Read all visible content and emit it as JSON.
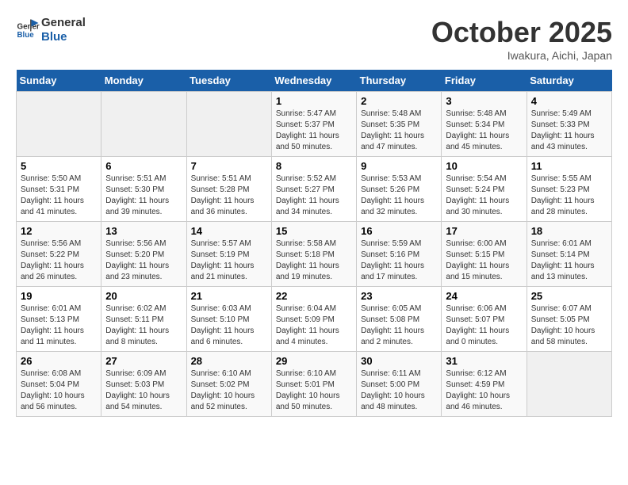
{
  "logo": {
    "line1": "General",
    "line2": "Blue"
  },
  "title": "October 2025",
  "subtitle": "Iwakura, Aichi, Japan",
  "days_of_week": [
    "Sunday",
    "Monday",
    "Tuesday",
    "Wednesday",
    "Thursday",
    "Friday",
    "Saturday"
  ],
  "weeks": [
    [
      {
        "day": "",
        "info": ""
      },
      {
        "day": "",
        "info": ""
      },
      {
        "day": "",
        "info": ""
      },
      {
        "day": "1",
        "info": "Sunrise: 5:47 AM\nSunset: 5:37 PM\nDaylight: 11 hours\nand 50 minutes."
      },
      {
        "day": "2",
        "info": "Sunrise: 5:48 AM\nSunset: 5:35 PM\nDaylight: 11 hours\nand 47 minutes."
      },
      {
        "day": "3",
        "info": "Sunrise: 5:48 AM\nSunset: 5:34 PM\nDaylight: 11 hours\nand 45 minutes."
      },
      {
        "day": "4",
        "info": "Sunrise: 5:49 AM\nSunset: 5:33 PM\nDaylight: 11 hours\nand 43 minutes."
      }
    ],
    [
      {
        "day": "5",
        "info": "Sunrise: 5:50 AM\nSunset: 5:31 PM\nDaylight: 11 hours\nand 41 minutes."
      },
      {
        "day": "6",
        "info": "Sunrise: 5:51 AM\nSunset: 5:30 PM\nDaylight: 11 hours\nand 39 minutes."
      },
      {
        "day": "7",
        "info": "Sunrise: 5:51 AM\nSunset: 5:28 PM\nDaylight: 11 hours\nand 36 minutes."
      },
      {
        "day": "8",
        "info": "Sunrise: 5:52 AM\nSunset: 5:27 PM\nDaylight: 11 hours\nand 34 minutes."
      },
      {
        "day": "9",
        "info": "Sunrise: 5:53 AM\nSunset: 5:26 PM\nDaylight: 11 hours\nand 32 minutes."
      },
      {
        "day": "10",
        "info": "Sunrise: 5:54 AM\nSunset: 5:24 PM\nDaylight: 11 hours\nand 30 minutes."
      },
      {
        "day": "11",
        "info": "Sunrise: 5:55 AM\nSunset: 5:23 PM\nDaylight: 11 hours\nand 28 minutes."
      }
    ],
    [
      {
        "day": "12",
        "info": "Sunrise: 5:56 AM\nSunset: 5:22 PM\nDaylight: 11 hours\nand 26 minutes."
      },
      {
        "day": "13",
        "info": "Sunrise: 5:56 AM\nSunset: 5:20 PM\nDaylight: 11 hours\nand 23 minutes."
      },
      {
        "day": "14",
        "info": "Sunrise: 5:57 AM\nSunset: 5:19 PM\nDaylight: 11 hours\nand 21 minutes."
      },
      {
        "day": "15",
        "info": "Sunrise: 5:58 AM\nSunset: 5:18 PM\nDaylight: 11 hours\nand 19 minutes."
      },
      {
        "day": "16",
        "info": "Sunrise: 5:59 AM\nSunset: 5:16 PM\nDaylight: 11 hours\nand 17 minutes."
      },
      {
        "day": "17",
        "info": "Sunrise: 6:00 AM\nSunset: 5:15 PM\nDaylight: 11 hours\nand 15 minutes."
      },
      {
        "day": "18",
        "info": "Sunrise: 6:01 AM\nSunset: 5:14 PM\nDaylight: 11 hours\nand 13 minutes."
      }
    ],
    [
      {
        "day": "19",
        "info": "Sunrise: 6:01 AM\nSunset: 5:13 PM\nDaylight: 11 hours\nand 11 minutes."
      },
      {
        "day": "20",
        "info": "Sunrise: 6:02 AM\nSunset: 5:11 PM\nDaylight: 11 hours\nand 8 minutes."
      },
      {
        "day": "21",
        "info": "Sunrise: 6:03 AM\nSunset: 5:10 PM\nDaylight: 11 hours\nand 6 minutes."
      },
      {
        "day": "22",
        "info": "Sunrise: 6:04 AM\nSunset: 5:09 PM\nDaylight: 11 hours\nand 4 minutes."
      },
      {
        "day": "23",
        "info": "Sunrise: 6:05 AM\nSunset: 5:08 PM\nDaylight: 11 hours\nand 2 minutes."
      },
      {
        "day": "24",
        "info": "Sunrise: 6:06 AM\nSunset: 5:07 PM\nDaylight: 11 hours\nand 0 minutes."
      },
      {
        "day": "25",
        "info": "Sunrise: 6:07 AM\nSunset: 5:05 PM\nDaylight: 10 hours\nand 58 minutes."
      }
    ],
    [
      {
        "day": "26",
        "info": "Sunrise: 6:08 AM\nSunset: 5:04 PM\nDaylight: 10 hours\nand 56 minutes."
      },
      {
        "day": "27",
        "info": "Sunrise: 6:09 AM\nSunset: 5:03 PM\nDaylight: 10 hours\nand 54 minutes."
      },
      {
        "day": "28",
        "info": "Sunrise: 6:10 AM\nSunset: 5:02 PM\nDaylight: 10 hours\nand 52 minutes."
      },
      {
        "day": "29",
        "info": "Sunrise: 6:10 AM\nSunset: 5:01 PM\nDaylight: 10 hours\nand 50 minutes."
      },
      {
        "day": "30",
        "info": "Sunrise: 6:11 AM\nSunset: 5:00 PM\nDaylight: 10 hours\nand 48 minutes."
      },
      {
        "day": "31",
        "info": "Sunrise: 6:12 AM\nSunset: 4:59 PM\nDaylight: 10 hours\nand 46 minutes."
      },
      {
        "day": "",
        "info": ""
      }
    ]
  ]
}
